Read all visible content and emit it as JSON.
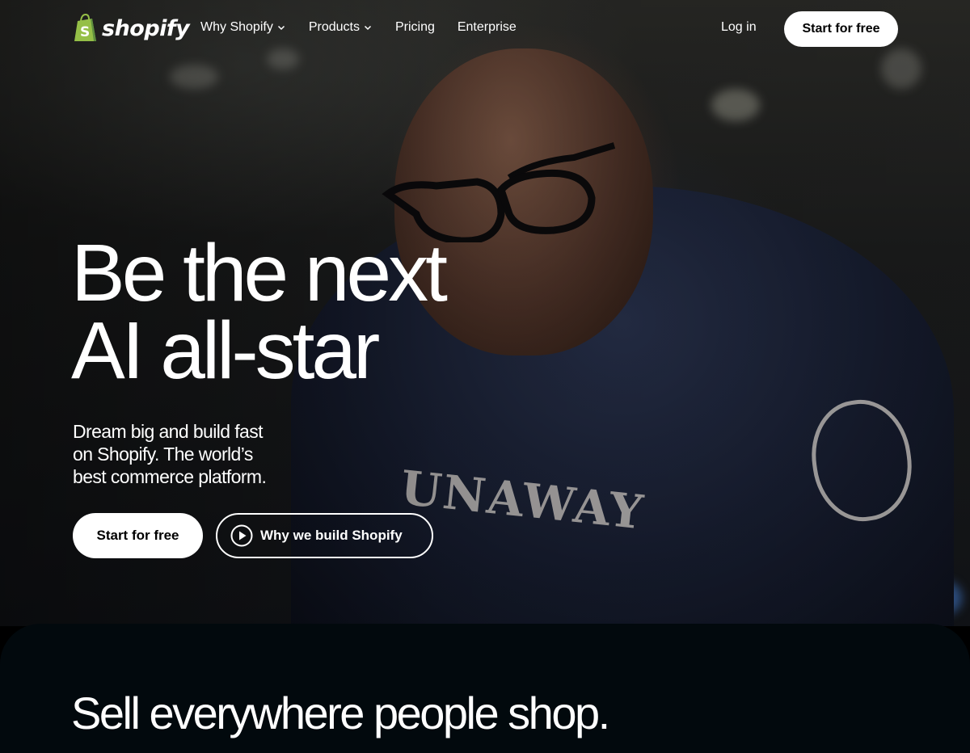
{
  "brand": {
    "name": "shopify",
    "logo_color": "#95bf47"
  },
  "nav": {
    "items": [
      {
        "label": "Why Shopify",
        "has_dropdown": true
      },
      {
        "label": "Products",
        "has_dropdown": true
      },
      {
        "label": "Pricing",
        "has_dropdown": false
      },
      {
        "label": "Enterprise",
        "has_dropdown": false
      }
    ],
    "login_label": "Log in",
    "cta_label": "Start for free"
  },
  "hero": {
    "headline_line1": "Be the next",
    "headline_line2": "AI all-star",
    "subtext_line1": "Dream big and build fast",
    "subtext_line2": "on Shopify. The world’s",
    "subtext_line3": "best commerce platform.",
    "primary_cta": "Start for free",
    "secondary_cta": "Why we build Shopify",
    "secondary_icon": "play-icon"
  },
  "section": {
    "title": "Sell everywhere people shop."
  }
}
